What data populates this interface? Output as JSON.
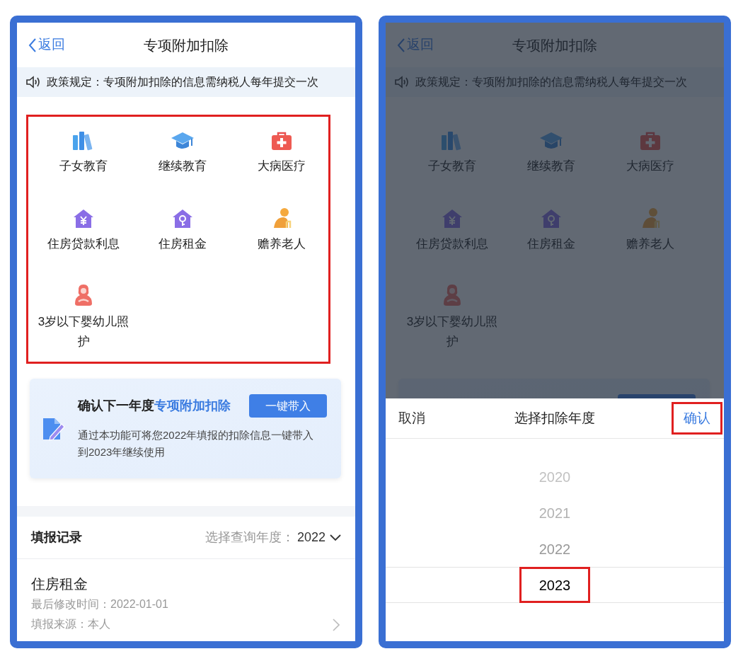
{
  "screens": [
    {
      "back": "返回",
      "title": "专项附加扣除",
      "notice": "政策规定：专项附加扣除的信息需纳税人每年提交一次",
      "categories_highlighted": true,
      "dimmed": false,
      "categories": [
        {
          "label": "子女教育",
          "kind": "books"
        },
        {
          "label": "继续教育",
          "kind": "cap"
        },
        {
          "label": "大病医疗",
          "kind": "medkit"
        },
        {
          "label": "住房贷款利息",
          "kind": "house-yen"
        },
        {
          "label": "住房租金",
          "kind": "house-key"
        },
        {
          "label": "赡养老人",
          "kind": "elder"
        },
        {
          "label": "3岁以下婴幼儿照护",
          "kind": "mother"
        }
      ],
      "promo": {
        "title": "确认下一年度",
        "title_accent": "专项附加扣除",
        "button": "一键带入",
        "description": "通过本功能可将您2022年填报的扣除信息一键带入到2023年继续使用"
      },
      "records": {
        "heading": "填报记录",
        "year_label": "选择查询年度：",
        "year": "2022",
        "item": {
          "title": "住房租金",
          "modified": "最后修改时间：2022-01-01",
          "source": "填报来源：本人"
        }
      }
    },
    {
      "back": "返回",
      "title": "专项附加扣除",
      "notice": "政策规定：专项附加扣除的信息需纳税人每年提交一次",
      "categories_highlighted": false,
      "dimmed": true,
      "categories": [
        {
          "label": "子女教育",
          "kind": "books"
        },
        {
          "label": "继续教育",
          "kind": "cap"
        },
        {
          "label": "大病医疗",
          "kind": "medkit"
        },
        {
          "label": "住房贷款利息",
          "kind": "house-yen"
        },
        {
          "label": "住房租金",
          "kind": "house-key"
        },
        {
          "label": "赡养老人",
          "kind": "elder"
        },
        {
          "label": "3岁以下婴幼儿照护",
          "kind": "mother"
        }
      ],
      "picker": {
        "cancel": "取消",
        "title": "选择扣除年度",
        "confirm": "确认",
        "confirm_highlighted": true,
        "years": [
          {
            "label": "2020",
            "selected": false,
            "highlighted": false
          },
          {
            "label": "2021",
            "selected": false,
            "highlighted": false
          },
          {
            "label": "2022",
            "selected": false,
            "highlighted": false
          },
          {
            "label": "2023",
            "selected": true,
            "highlighted": true
          }
        ]
      }
    }
  ]
}
